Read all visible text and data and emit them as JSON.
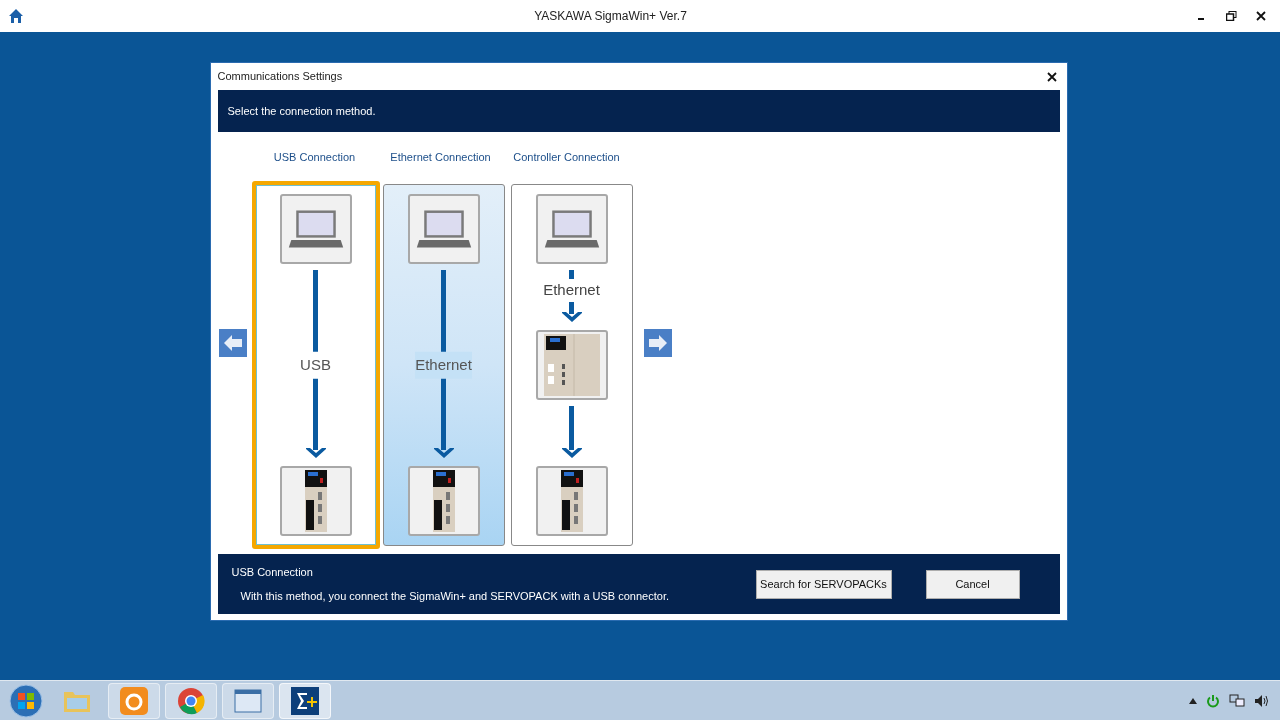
{
  "app": {
    "title": "YASKAWA SigmaWin+ Ver.7"
  },
  "dialog": {
    "title": "Communications Settings",
    "instruction": "Select the connection method.",
    "methods": [
      {
        "label": "USB Connection",
        "kind": "direct",
        "link_label": "USB",
        "selected": true,
        "hovered": false
      },
      {
        "label": "Ethernet Connection",
        "kind": "direct",
        "link_label": "Ethernet",
        "selected": false,
        "hovered": true
      },
      {
        "label": "Controller Connection",
        "kind": "via-controller",
        "link_label": "Ethernet",
        "selected": false,
        "hovered": false
      }
    ],
    "description": {
      "title": "USB Connection",
      "text": "With this method, you connect the SigmaWin+ and SERVOPACK with a USB connector."
    },
    "buttons": [
      "Search for SERVOPACKs",
      "Cancel"
    ]
  }
}
